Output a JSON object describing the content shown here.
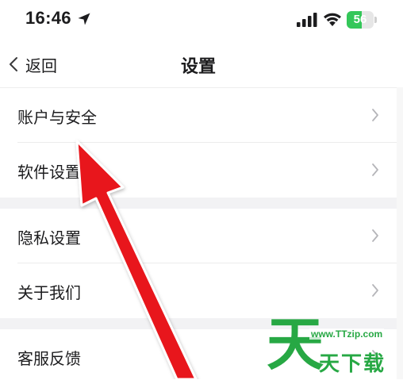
{
  "status_bar": {
    "time": "16:46",
    "battery_level": "56",
    "battery_percent": 56,
    "icons": [
      "location-arrow-icon",
      "cellular-signal-icon",
      "wifi-icon",
      "battery-icon"
    ]
  },
  "nav": {
    "back_label": "返回",
    "title": "设置"
  },
  "groups": [
    {
      "items": [
        {
          "label": "账户与安全"
        },
        {
          "label": "软件设置"
        }
      ]
    },
    {
      "items": [
        {
          "label": "隐私设置"
        },
        {
          "label": "关于我们"
        }
      ]
    },
    {
      "items": [
        {
          "label": "客服反馈"
        }
      ]
    }
  ],
  "watermark": {
    "big_char": "天",
    "url": "www.TTzip.com",
    "text": "天下载"
  },
  "colors": {
    "accent_arrow": "#e8161b",
    "battery_green": "#34c759",
    "watermark_green": "#27a844",
    "group_gap": "#f2f2f4"
  }
}
